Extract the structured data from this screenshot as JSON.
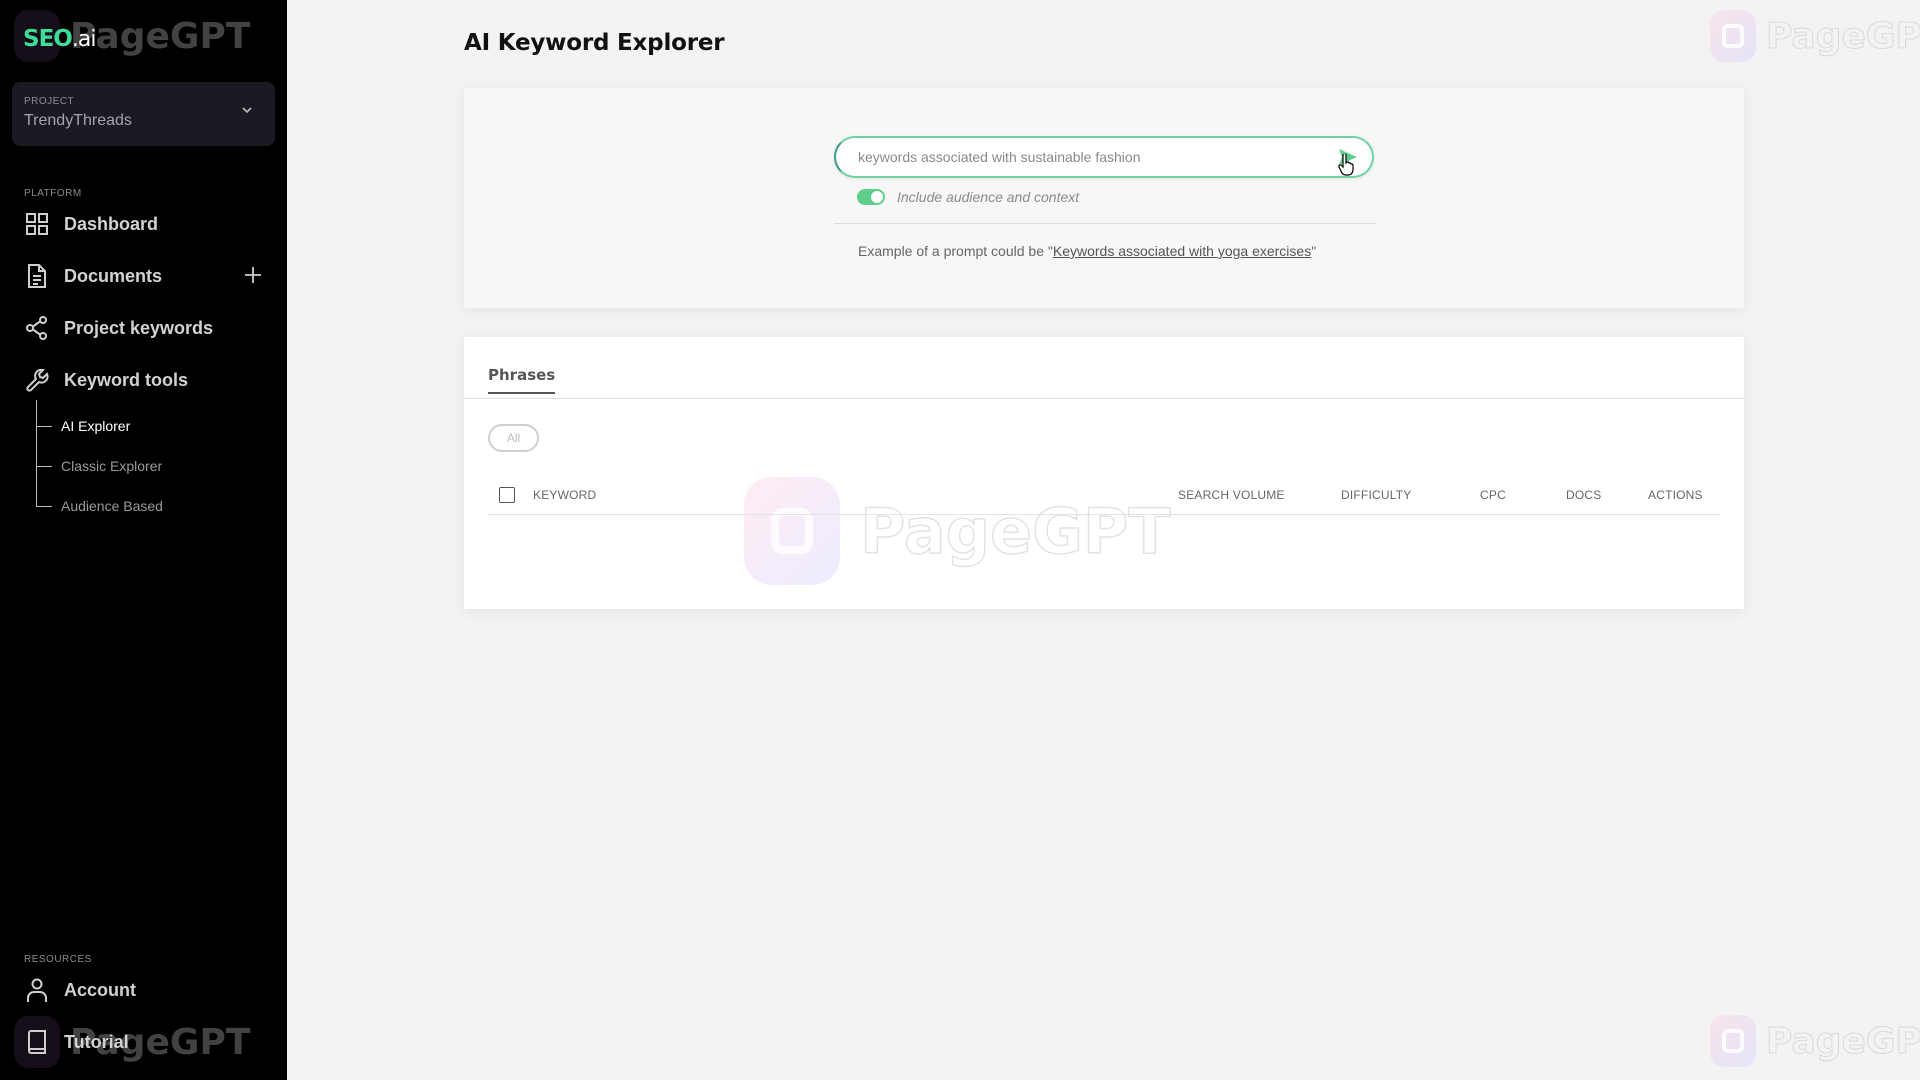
{
  "app": {
    "logo_main": "SEO",
    "logo_suffix": ".ai",
    "watermark_text": "PageGPT"
  },
  "sidebar": {
    "project": {
      "label": "PROJECT",
      "value": "TrendyThreads"
    },
    "platform_label": "PLATFORM",
    "items": [
      {
        "label": "Dashboard",
        "icon": "grid-icon"
      },
      {
        "label": "Documents",
        "icon": "document-icon",
        "action": "plus-icon"
      },
      {
        "label": "Project keywords",
        "icon": "share-icon"
      },
      {
        "label": "Keyword tools",
        "icon": "wrench-icon"
      }
    ],
    "sub_items": [
      {
        "label": "AI Explorer",
        "active": true
      },
      {
        "label": "Classic Explorer",
        "active": false
      },
      {
        "label": "Audience Based",
        "active": false
      }
    ],
    "resources_label": "RESOURCES",
    "resources": [
      {
        "label": "Account",
        "icon": "user-icon"
      },
      {
        "label": "Tutorial",
        "icon": "book-icon"
      }
    ]
  },
  "main": {
    "title": "AI Keyword Explorer",
    "search": {
      "value": "",
      "placeholder": "keywords associated with sustainable fashion",
      "toggle_label": "Include audience and context",
      "toggle_on": true,
      "example_prefix": "Example of a prompt could be \"",
      "example_link": "Keywords associated with yoga exercises",
      "example_suffix": "\""
    },
    "results": {
      "tabs": [
        {
          "label": "Phrases",
          "active": true
        }
      ],
      "filter_chip": "All",
      "columns": [
        "KEYWORD",
        "SEARCH VOLUME",
        "DIFFICULTY",
        "CPC",
        "DOCS",
        "ACTIONS"
      ],
      "rows": []
    }
  },
  "colors": {
    "accent": "#3ddc97",
    "toggle": "#5fce8a",
    "sidebar_bg": "#000000",
    "page_bg": "#f3f3f3"
  }
}
